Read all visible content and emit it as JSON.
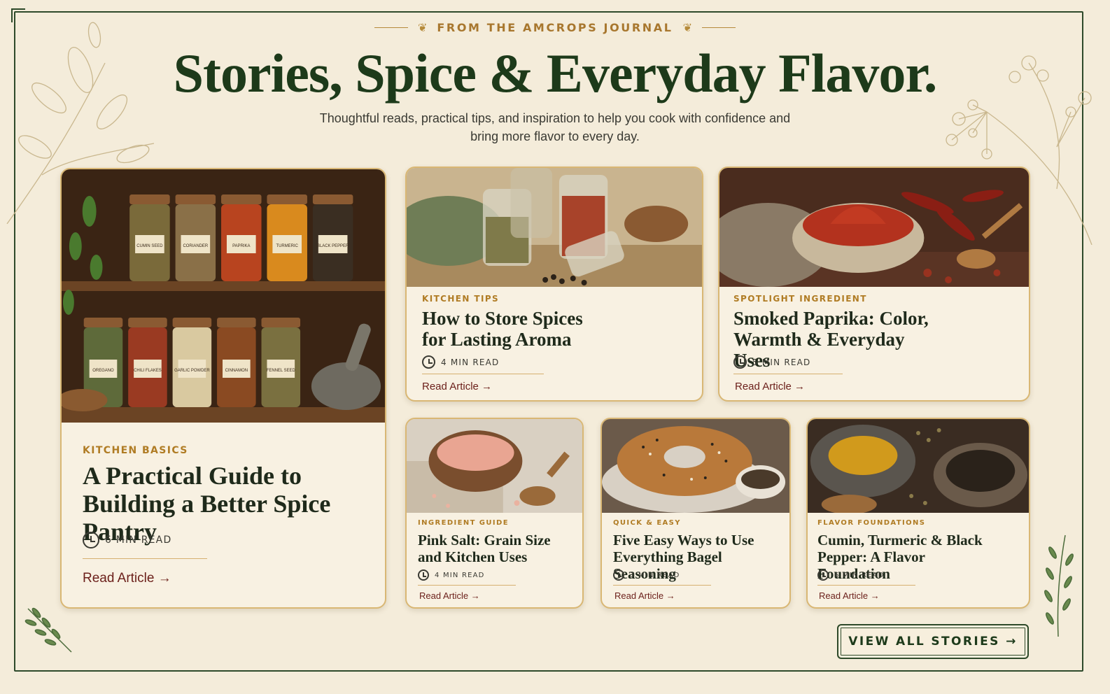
{
  "header": {
    "eyebrow": "FROM THE AMCROPS JOURNAL",
    "headline": "Stories, Spice & Everyday Flavor.",
    "subhead": "Thoughtful reads, practical tips, and inspiration to help you cook with confidence and bring more flavor to every day."
  },
  "featured": {
    "category": "KITCHEN BASICS",
    "title": "A Practical Guide to Building a Better Spice Pantry",
    "read_time": "6 MIN READ",
    "link": "Read Article →",
    "image": "spice-pantry-shelf",
    "jar_labels": [
      "CUMIN SEED",
      "CORIANDER",
      "PAPRIKA",
      "TURMERIC",
      "BLACK PEPPER",
      "OREGANO",
      "CHILI FLAKES",
      "GARLIC POWDER",
      "CINNAMON",
      "FENNEL SEED"
    ]
  },
  "cards": [
    {
      "category": "KITCHEN TIPS",
      "title": "How to Store Spices for Lasting Aroma",
      "read_time": "4 MIN READ",
      "link": "Read Article →",
      "image": "spice-jars"
    },
    {
      "category": "SPOTLIGHT INGREDIENT",
      "title": "Smoked Paprika: Color, Warmth & Everyday Uses",
      "read_time": "5 MIN READ",
      "link": "Read Article →",
      "image": "paprika-bowl"
    },
    {
      "category": "INGREDIENT GUIDE",
      "title": "Pink Salt: Grain Size and Kitchen Uses",
      "read_time": "4 MIN READ",
      "link": "Read Article →",
      "image": "pink-salt"
    },
    {
      "category": "QUICK & EASY",
      "title": "Five Easy Ways to Use Everything Bagel Seasoning",
      "read_time": "3 MIN READ",
      "link": "Read Article →",
      "image": "bagel"
    },
    {
      "category": "FLAVOR FOUNDATIONS",
      "title": "Cumin, Turmeric & Black Pepper: A Flavor Foundation",
      "read_time": "6 MIN READ",
      "link": "Read Article →",
      "image": "spice-bowls"
    }
  ],
  "cta": {
    "label": "VIEW ALL STORIES →"
  },
  "colors": {
    "background": "#f4ecda",
    "accent": "#b07c24",
    "primary": "#1d3a1a",
    "link": "#6b1f1a",
    "border": "#d9b774"
  }
}
